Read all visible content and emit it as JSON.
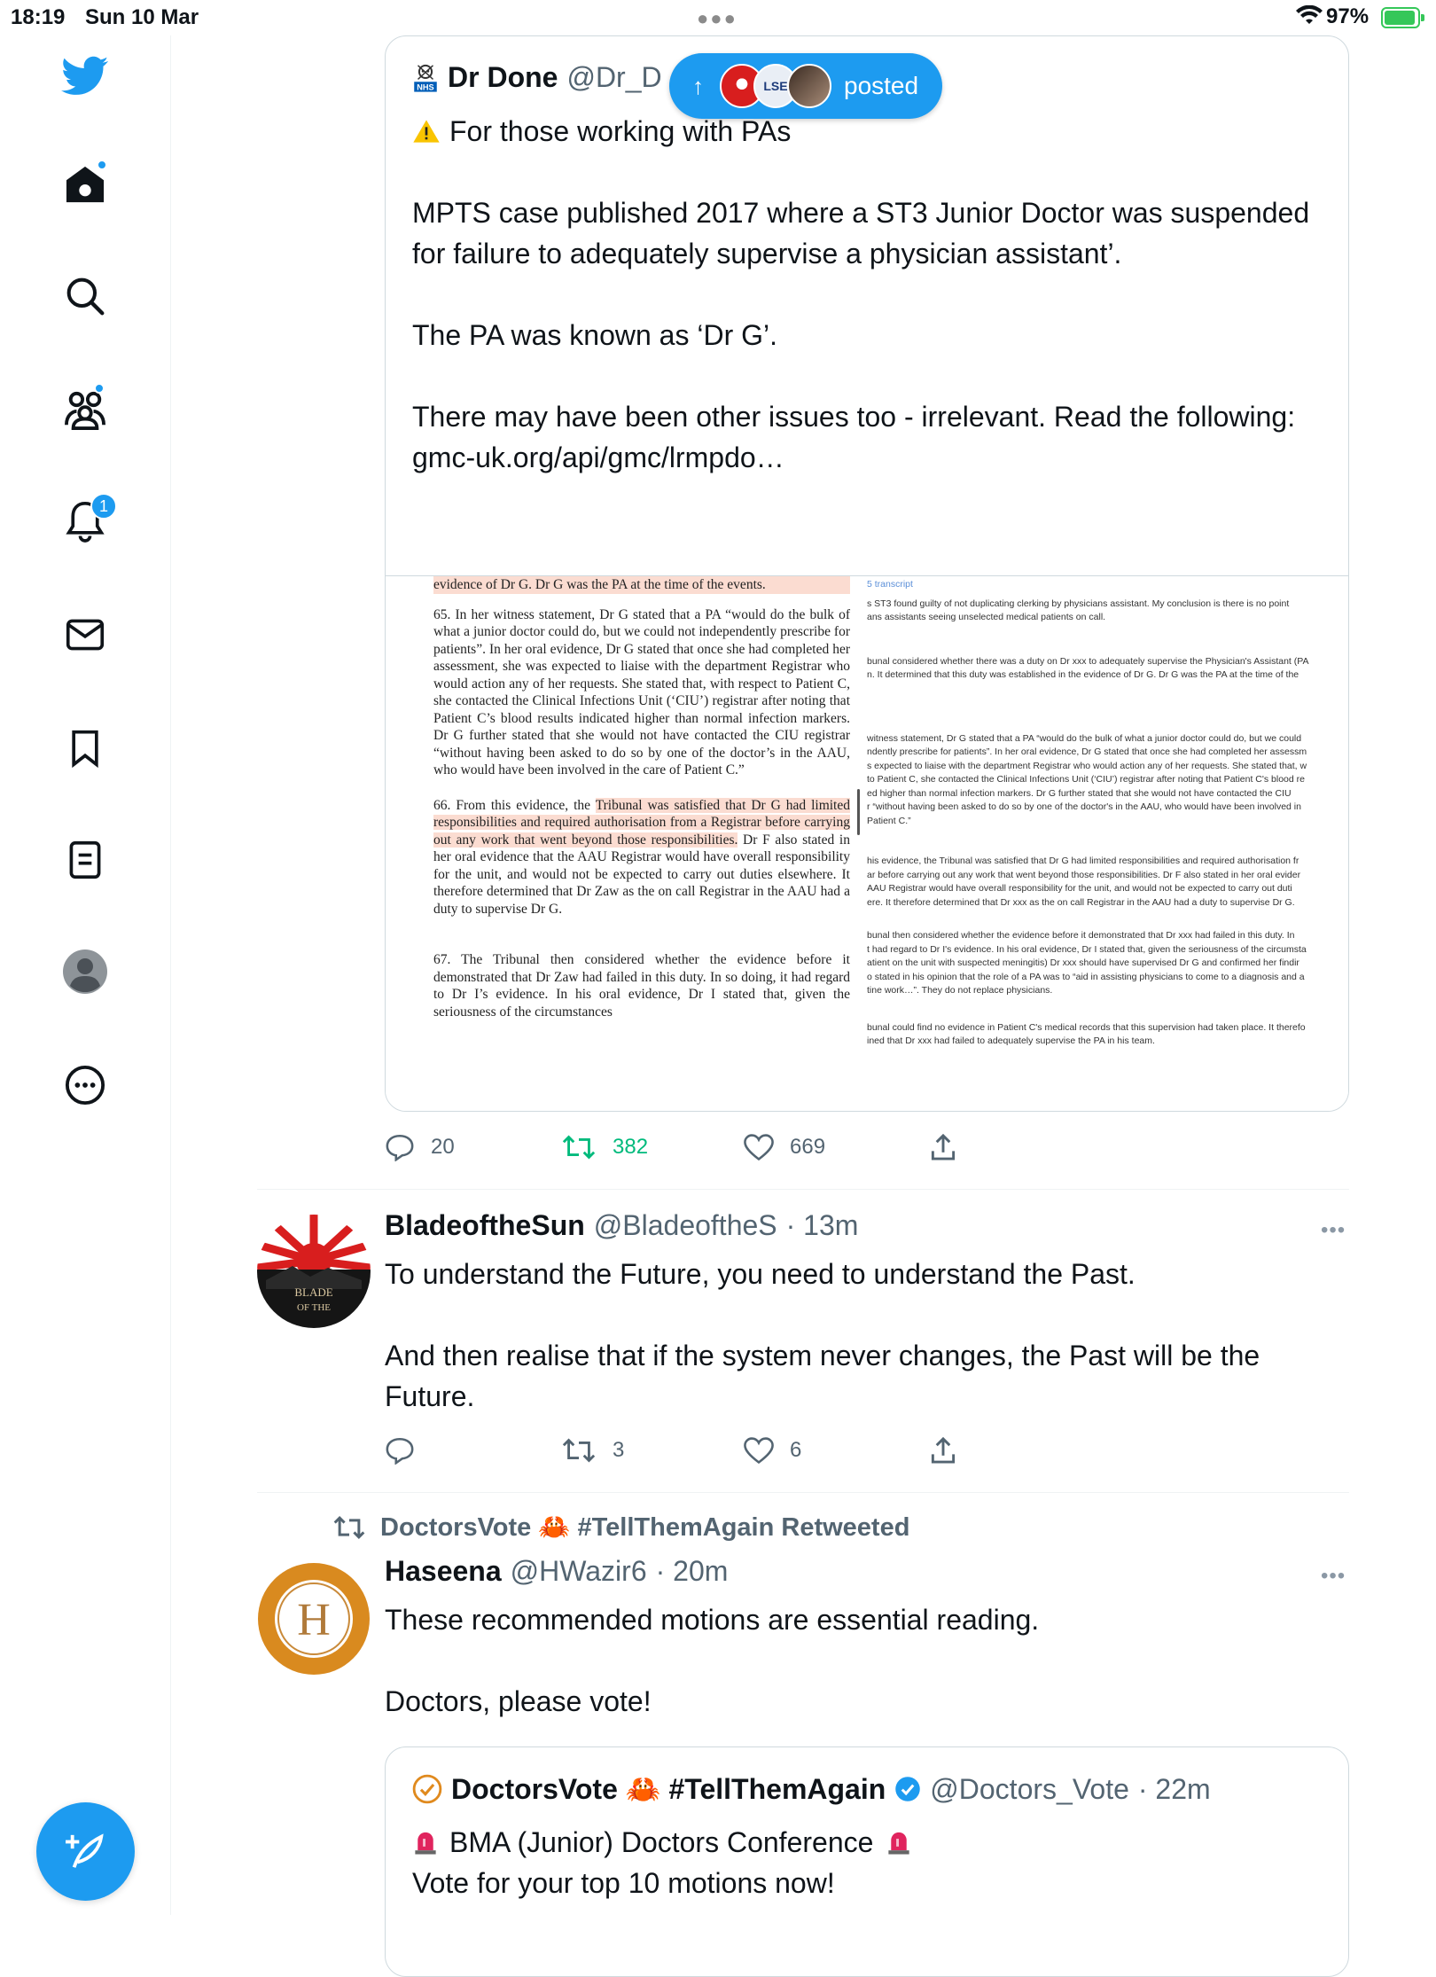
{
  "status_bar": {
    "time": "18:19",
    "date": "Sun 10 Mar",
    "battery": "97%"
  },
  "sidebar": {
    "notifications_count": "1"
  },
  "quoted_tweet": {
    "name": "Dr Done",
    "handle": "@Dr_D",
    "paragraphs": [
      "For those working with PAs",
      "MPTS case published 2017 where a ST3 Junior Doctor was suspended for failure to adequately supervise a physician assistant’.",
      "The PA was known as ‘Dr G’.",
      "There may have been other issues too - irrelevant. Read the following: gmc-uk.org/api/gmc/lrmpdo…"
    ],
    "doc_left": {
      "top_line": "evidence of Dr G. Dr G was the PA at the time of the events.",
      "p65": "65.     In her witness statement, Dr G stated that a PA “would do the bulk of what a junior doctor could do, but we could not independently prescribe for patients”. In her oral evidence, Dr G stated that once she had completed her assessment, she was expected to liaise with the department Registrar who would action any of her requests. She stated that, with respect to Patient C, she contacted the Clinical Infections Unit (‘CIU’) registrar after noting that Patient C’s blood results indicated higher than normal infection markers. Dr G further stated that she would not have contacted the CIU registrar “without having been asked to do so by one of the doctor’s in the AAU, who would have been involved in the care of Patient C.”",
      "p66_a": "66.     From this evidence, the ",
      "p66_hl": "Tribunal was satisfied that Dr G had limited responsibilities and required authorisation from a Registrar before carrying out any work that went beyond those responsibilities.",
      "p66_b": " Dr F also stated in her oral evidence that the AAU Registrar would have overall responsibility for the unit, and would not be expected to carry out duties elsewhere. It therefore determined that Dr Zaw as the on call Registrar in the AAU had a duty to supervise Dr G.",
      "p67": "67.     The Tribunal then considered whether the evidence before it demonstrated that Dr Zaw had failed in this duty. In so doing, it had regard to Dr I’s evidence. In his oral evidence, Dr I stated that, given the seriousness of the circumstances"
    },
    "doc_right": {
      "header": "5 transcript",
      "p1": [
        "s ST3 found guilty of not duplicating clerking by physicians assistant. My conclusion is there is no point",
        "ans assistants seeing unselected medical patients on call."
      ],
      "p2": [
        "bunal considered whether there was a duty on Dr xxx to adequately supervise the Physician's Assistant (PA",
        "n. It determined that this duty was established in the evidence of Dr G. Dr G was the PA at the time of the"
      ],
      "p3": [
        "witness statement, Dr G stated that a PA “would do the bulk of what a junior doctor could do, but we could",
        "ndently prescribe for patients”. In her oral evidence, Dr G stated that once she had completed her assessm",
        "s expected to liaise with the department Registrar who would action any of her requests. She stated that, w",
        "to Patient C, she contacted the Clinical Infections Unit (‘CIU’) registrar after noting that Patient C's blood re",
        "ed higher than normal infection markers. Dr G further stated that she would not have contacted the CIU",
        "r “without having been asked to do so by one of the doctor's in the AAU, who would have been involved in",
        "Patient C.”"
      ],
      "p4": [
        "his evidence, the Tribunal was satisfied that Dr G had limited responsibilities and required authorisation fr",
        "ar before carrying out any work that went beyond those responsibilities. Dr F also stated in her oral evider",
        "AAU Registrar would have overall responsibility for the unit, and would not be expected to carry out duti",
        "ere. It therefore determined that Dr xxx as the on call Registrar in the AAU had a duty to supervise Dr G."
      ],
      "p5": [
        "bunal then considered whether the evidence before it demonstrated that Dr xxx had failed in this duty. In",
        "t had regard to Dr I's evidence. In his oral evidence, Dr I stated that, given the seriousness of the circumsta",
        "atient on the unit with suspected meningitis) Dr xxx should have supervised Dr G and confirmed her findir",
        "o stated in his opinion that the role of a PA was to “aid in assisting physicians to come to a diagnosis and a",
        "tine work…”. They do not replace physicians."
      ],
      "p6": [
        "bunal could find no evidence in Patient C's medical records that this supervision had taken place. It therefo",
        "ined that Dr xxx had failed to adequately supervise the PA in his team."
      ]
    },
    "replies": "20",
    "retweets": "382",
    "likes": "669"
  },
  "posted_pill": {
    "label": "posted"
  },
  "tweet_blade": {
    "name": "BladeoftheSun",
    "handle": "@BladeoftheS",
    "time": "· 13m",
    "paragraphs": [
      "To understand the Future, you need to understand the Past.",
      "And then realise that if the system never changes, the Past will be the Future."
    ],
    "replies": "",
    "retweets": "3",
    "likes": "6"
  },
  "tweet_haseena": {
    "retweeted_by": "DoctorsVote 🦀 #TellThemAgain Retweeted",
    "name": "Haseena",
    "handle": "@HWazir6",
    "time": "· 20m",
    "paragraphs": [
      "These recommended motions are essential reading.",
      "Doctors, please vote!"
    ]
  },
  "quoted_tweet2": {
    "name": "DoctorsVote 🦀 #TellThemAgain",
    "handle": "@Doctors_Vote",
    "time": "· 22m",
    "line1": "BMA (Junior) Doctors Conference",
    "line2": "Vote for your top 10 motions now!"
  },
  "colors": {
    "accent": "#1d9bf0",
    "retweet_green": "#00ba7c",
    "muted": "#536471"
  }
}
